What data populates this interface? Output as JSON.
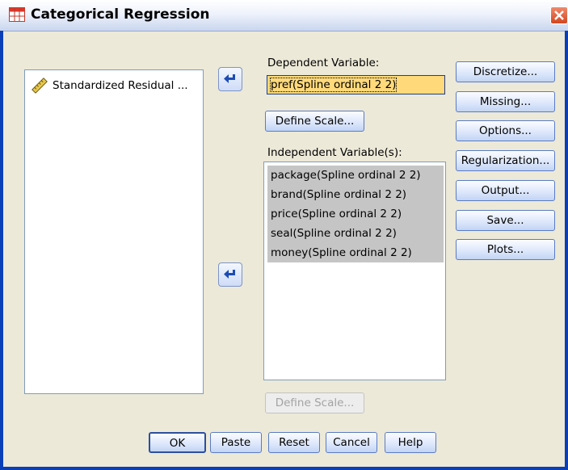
{
  "window": {
    "title": "Categorical Regression"
  },
  "source_list": {
    "items": [
      {
        "label": "Standardized Residual ...",
        "icon": "ruler-scale-icon"
      }
    ]
  },
  "dependent": {
    "label": "Dependent Variable:",
    "value": "pref(Spline ordinal 2 2)",
    "define_scale_label": "Define Scale..."
  },
  "independent": {
    "label": "Independent Variable(s):",
    "items": [
      "package(Spline ordinal 2 2)",
      "brand(Spline ordinal 2 2)",
      "price(Spline ordinal 2 2)",
      "seal(Spline ordinal 2 2)",
      "money(Spline ordinal 2 2)"
    ],
    "define_scale_label": "Define Scale..."
  },
  "side_buttons": {
    "discretize": "Discretize...",
    "missing": "Missing...",
    "options": "Options...",
    "regularization": "Regularization...",
    "output": "Output...",
    "save": "Save...",
    "plots": "Plots..."
  },
  "bottom_buttons": {
    "ok": "OK",
    "paste": "Paste",
    "reset": "Reset",
    "cancel": "Cancel",
    "help": "Help"
  },
  "colors": {
    "selected_field": "#ffd97a",
    "selection_gray": "#c5c5c5",
    "dialog_bg": "#ece9d8",
    "frame_blue": "#0a3fb8"
  }
}
